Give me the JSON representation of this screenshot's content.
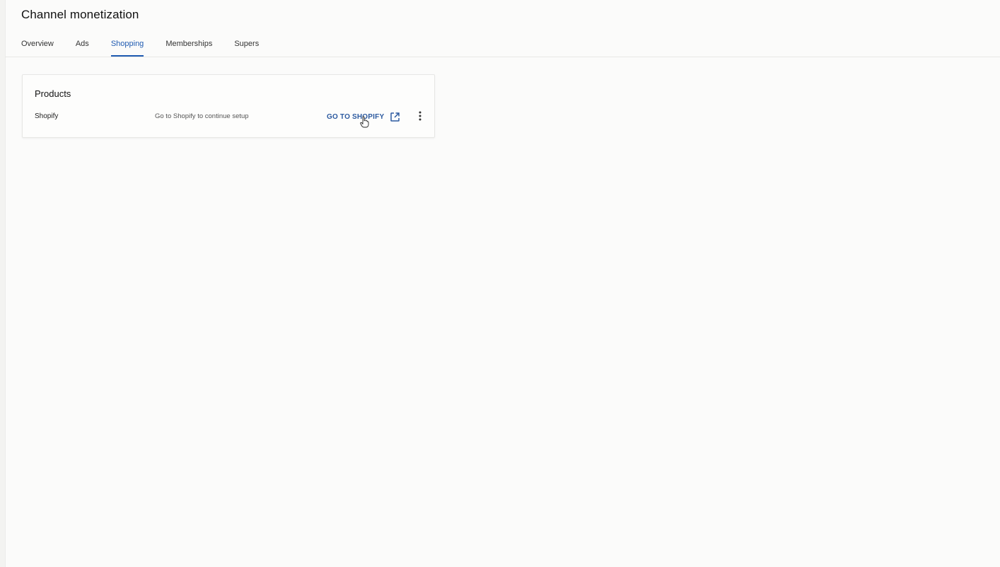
{
  "page": {
    "title": "Channel monetization"
  },
  "tabs": [
    {
      "label": "Overview",
      "active": false
    },
    {
      "label": "Ads",
      "active": false
    },
    {
      "label": "Shopping",
      "active": true
    },
    {
      "label": "Memberships",
      "active": false
    },
    {
      "label": "Supers",
      "active": false
    }
  ],
  "products_card": {
    "title": "Products",
    "rows": [
      {
        "name": "Shopify",
        "status": "Go to Shopify to continue setup",
        "action_label": "GO TO SHOPIFY",
        "action_icon": "external-link-icon",
        "menu_icon": "more-vert-icon"
      }
    ]
  },
  "colors": {
    "accent": "#1f5bb1",
    "button_text": "#2c5aa0",
    "background": "#fbfbfa"
  }
}
